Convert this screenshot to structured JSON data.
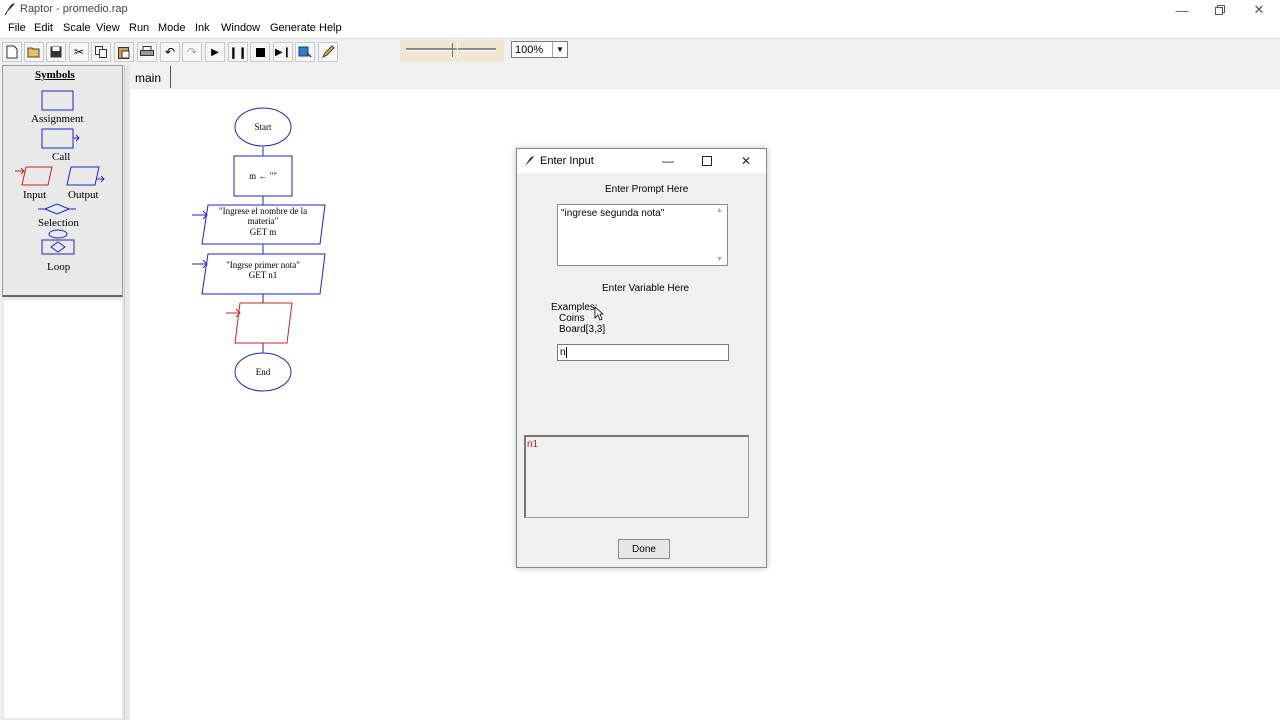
{
  "window": {
    "title": "Raptor - promedio.rap"
  },
  "menu": [
    "File",
    "Edit",
    "Scale",
    "View",
    "Run",
    "Mode",
    "Ink",
    "Window",
    "Generate",
    "Help"
  ],
  "toolbar": {
    "zoom_value": "100%"
  },
  "symbols_panel": {
    "header": "Symbols",
    "items": [
      "Assignment",
      "Call",
      "Input",
      "Output",
      "Selection",
      "Loop"
    ]
  },
  "tabs": [
    "main"
  ],
  "flowchart": {
    "start": "Start",
    "assign": "m ← \"\"",
    "input1_line1": "\"Ingrese el nombre de la",
    "input1_line2": "materia\"",
    "input1_line3": "GET m",
    "input2_line1": "\"Ingrse primer nota\"",
    "input2_line2": "GET n1",
    "end": "End"
  },
  "dialog": {
    "title": "Enter Input",
    "prompt_label": "Enter Prompt Here",
    "prompt_value": "\"ingrese segunda nota\"",
    "variable_label": "Enter Variable Here",
    "examples_label": "Examples:",
    "example_1": "Coins",
    "example_2": "Board[3,3]",
    "variable_value": "n",
    "hint_value": "n1",
    "done_label": "Done"
  }
}
